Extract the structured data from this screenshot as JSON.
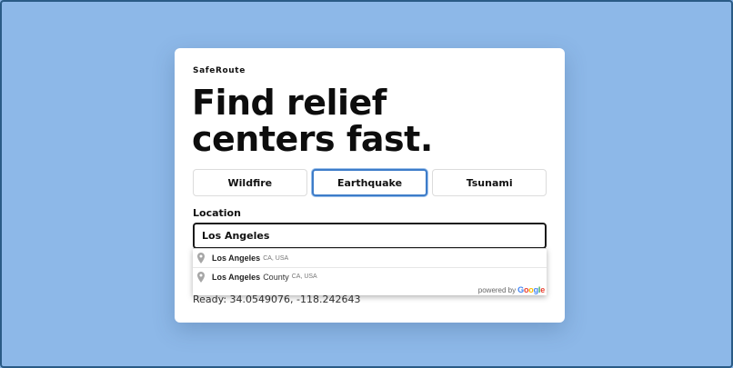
{
  "app": {
    "brand": "SafeRoute"
  },
  "hero": {
    "line1": "Find relief",
    "line2": "centers fast."
  },
  "tabs": [
    {
      "label": "Wildfire",
      "active": false
    },
    {
      "label": "Earthquake",
      "active": true
    },
    {
      "label": "Tsunami",
      "active": false
    }
  ],
  "location": {
    "label": "Location",
    "value": "Los Angeles"
  },
  "status": {
    "text": "Ready: 34.0549076, -118.242643"
  },
  "autocomplete": {
    "items": [
      {
        "main": "Los Angeles",
        "rest": "",
        "secondary": "CA, USA",
        "icon": "map-pin-icon"
      },
      {
        "main": "Los Angeles",
        "rest": "County",
        "secondary": "CA, USA",
        "icon": "map-pin-icon"
      }
    ],
    "powered_by": "powered by",
    "logo_letters": [
      "G",
      "o",
      "o",
      "g",
      "l",
      "e"
    ]
  }
}
